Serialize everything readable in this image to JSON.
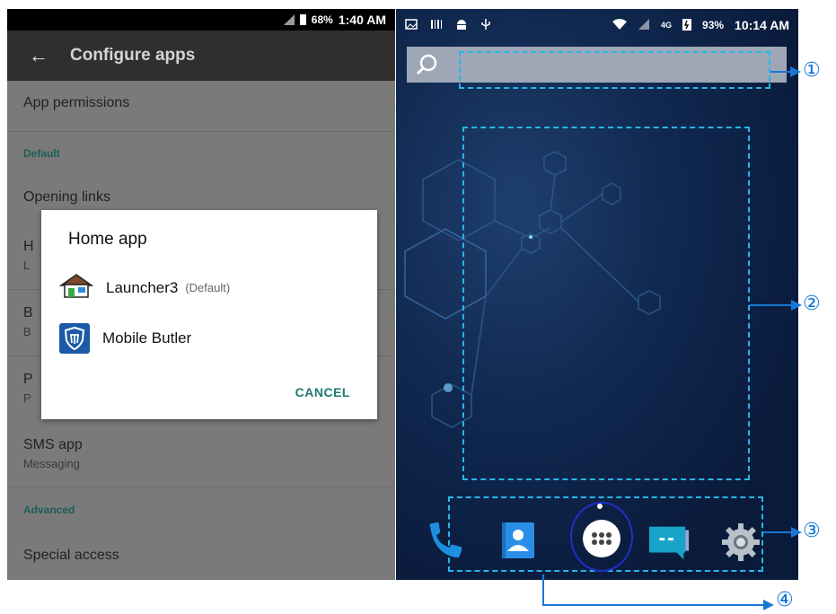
{
  "left_screen": {
    "status": {
      "battery": "68%",
      "time": "1:40 AM"
    },
    "appbar": {
      "title": "Configure apps"
    },
    "rows": {
      "app_permissions": "App permissions",
      "section_default": "Default",
      "opening_links": "Opening links",
      "sms_app": "SMS app",
      "sms_sub": "Messaging",
      "section_advanced": "Advanced",
      "special_access": "Special access",
      "partial": [
        {
          "main": "H",
          "sub": "L"
        },
        {
          "main": "B",
          "sub": "B"
        },
        {
          "main": "P",
          "sub": "P"
        }
      ]
    },
    "dialog": {
      "title": "Home app",
      "options": [
        {
          "label": "Launcher3",
          "note": "(Default)",
          "icon": "house-icon"
        },
        {
          "label": "Mobile Butler",
          "note": "",
          "icon": "shield-icon"
        }
      ],
      "cancel": "CANCEL"
    }
  },
  "right_screen": {
    "status": {
      "battery": "93%",
      "time": "10:14 AM",
      "network": "4G"
    },
    "dock_icons": [
      "phone-icon",
      "contacts-icon",
      "all-apps-icon",
      "messages-icon",
      "settings-icon"
    ]
  },
  "callouts": [
    "①",
    "②",
    "③",
    "④"
  ],
  "colors": {
    "dash": "#27b6e8",
    "callout": "#1877d4",
    "accent": "#1f7a70"
  }
}
